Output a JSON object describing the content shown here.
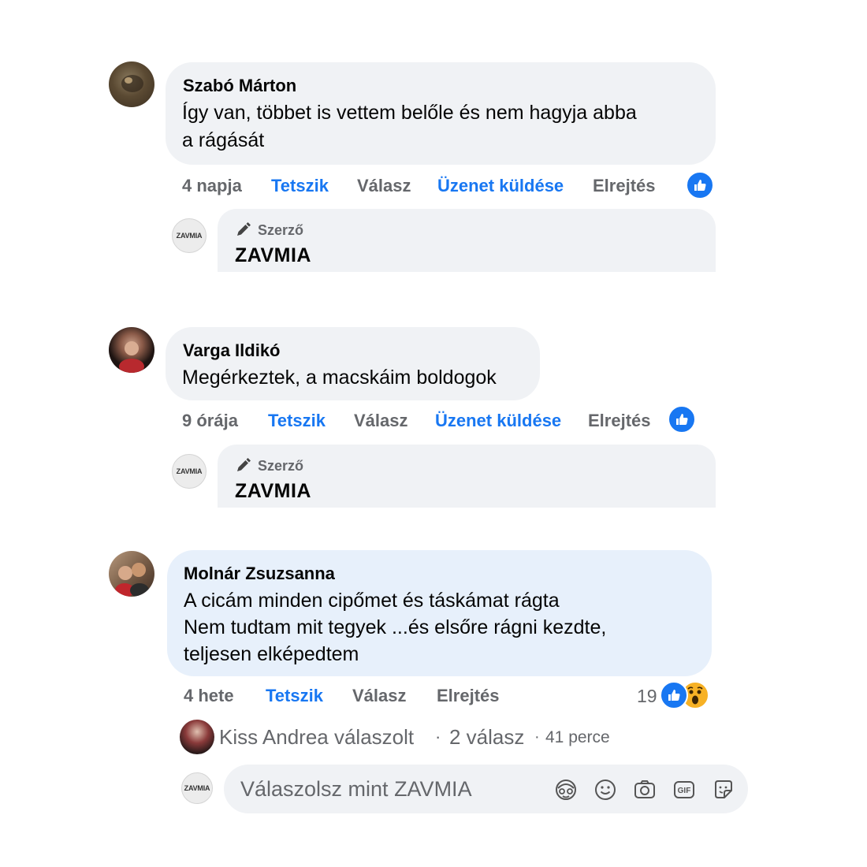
{
  "comments": [
    {
      "author": "Szabó Márton",
      "lines": [
        "Így van, többet is vettem belőle és nem hagyja abba",
        "a rágását"
      ],
      "time": "4 napja",
      "actions": {
        "like": "Tetszik",
        "reply": "Válasz",
        "message": "Üzenet küldése",
        "hide": "Elrejtés"
      },
      "reply": {
        "tag": "Szerző",
        "name": "ZAVMIA",
        "avatar_text": "ZAVMIA"
      }
    },
    {
      "author": "Varga Ildikó",
      "lines": [
        "Megérkeztek, a macskáim boldogok"
      ],
      "time": "9 órája",
      "actions": {
        "like": "Tetszik",
        "reply": "Válasz",
        "message": "Üzenet küldése",
        "hide": "Elrejtés"
      },
      "reply": {
        "tag": "Szerző",
        "name": "ZAVMIA",
        "avatar_text": "ZAVMIA"
      }
    },
    {
      "author": "Molnár Zsuzsanna",
      "lines": [
        "A cicám minden cipőmet és táskámat rágta",
        "Nem tudtam mit tegyek ...és elsőre rágni kezdte,",
        "teljesen elképedtem"
      ],
      "time": "4 hete",
      "actions": {
        "like": "Tetszik",
        "reply": "Válasz",
        "hide": "Elrejtés"
      },
      "reaction_count": "19",
      "replies_summary": {
        "who": "Kiss Andrea válaszolt",
        "sep1": "·",
        "count": "2 válasz",
        "sep2": "·",
        "time": "41 perce"
      }
    }
  ],
  "reply_box": {
    "placeholder": "Válaszolsz mint ZAVMIA",
    "avatar_text": "ZAVMIA",
    "tools": [
      "avatar-sticker-icon",
      "emoji-icon",
      "camera-icon",
      "gif-icon",
      "sticker-icon"
    ]
  },
  "colors": {
    "link_blue": "#1877f2",
    "meta_gray": "#65676b",
    "bubble": "#f0f2f5",
    "highlight_bubble": "#e7f0fb"
  }
}
